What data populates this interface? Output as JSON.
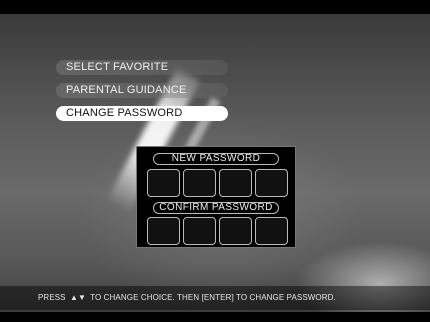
{
  "menu": {
    "items": [
      {
        "label": "SELECT FAVORITE",
        "selected": false
      },
      {
        "label": "PARENTAL GUIDANCE",
        "selected": false
      },
      {
        "label": "CHANGE PASSWORD",
        "selected": true
      }
    ]
  },
  "password_dialog": {
    "new_label": "NEW PASSWORD",
    "confirm_label": "CONFIRM PASSWORD",
    "digits": 4
  },
  "footer": {
    "hint_before": "PRESS",
    "arrows_icon": "up-down-arrows-icon",
    "arrows_glyph": "▲▼",
    "hint_after": "TO CHANGE CHOICE. THEN [ENTER] TO CHANGE PASSWORD."
  }
}
